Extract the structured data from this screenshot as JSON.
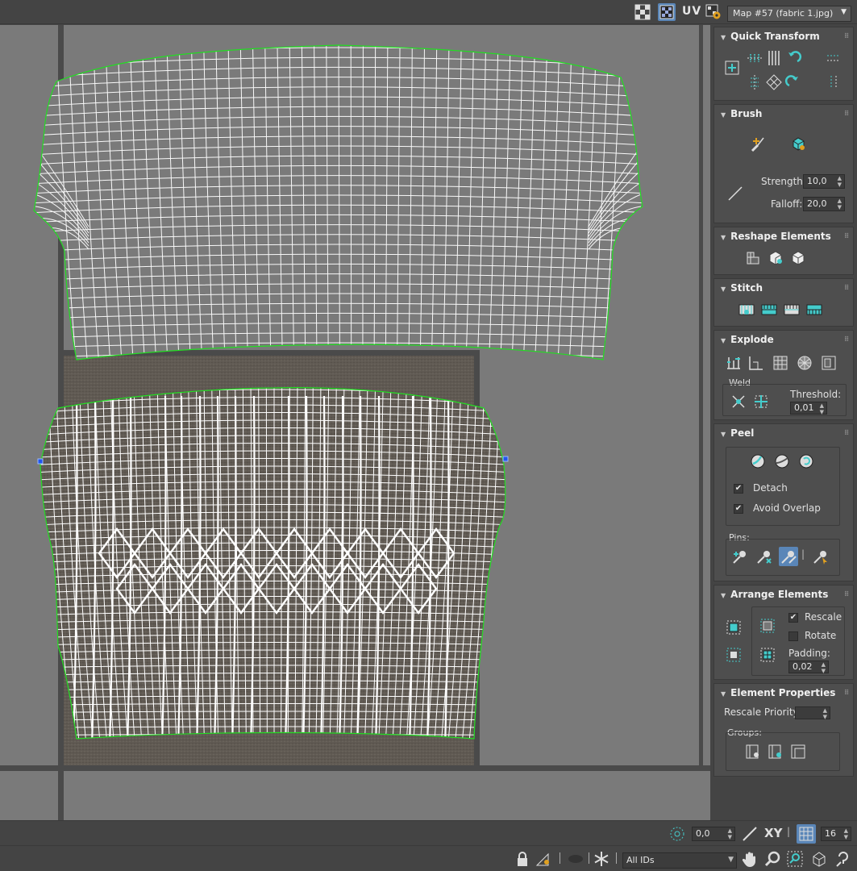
{
  "toolbar": {
    "uv_label": "UV",
    "map_select": "Map #57 (fabric 1.jpg)"
  },
  "panel": {
    "quick_transform": {
      "title": "Quick Transform"
    },
    "brush": {
      "title": "Brush",
      "strength_label": "Strength:",
      "strength_value": "10,0",
      "falloff_label": "Falloff:",
      "falloff_value": "20,0"
    },
    "reshape": {
      "title": "Reshape Elements"
    },
    "stitch": {
      "title": "Stitch"
    },
    "explode": {
      "title": "Explode",
      "weld_label": "Weld",
      "threshold_label": "Threshold:",
      "threshold_value": "0,01"
    },
    "peel": {
      "title": "Peel",
      "detach_label": "Detach",
      "detach_checked": true,
      "avoid_overlap_label": "Avoid Overlap",
      "avoid_overlap_checked": true,
      "pins_label": "Pins:"
    },
    "arrange": {
      "title": "Arrange Elements",
      "rescale_label": "Rescale",
      "rescale_checked": true,
      "rotate_label": "Rotate",
      "rotate_checked": false,
      "padding_label": "Padding:",
      "padding_value": "0,02"
    },
    "element_props": {
      "title": "Element Properties",
      "rescale_priority_label": "Rescale Priority:",
      "rescale_priority_value": "",
      "groups_label": "Groups:"
    }
  },
  "bottom": {
    "value_field": "0,0",
    "xy_label": "XY",
    "grid_value": "16",
    "ids_select": "All IDs"
  },
  "colors": {
    "seam_green": "#22dd22",
    "wire_white": "#ffffff",
    "viewport_bg": "#7a7a7a",
    "texture_bg": "#605a53",
    "accent_blue": "#5a86b8"
  }
}
